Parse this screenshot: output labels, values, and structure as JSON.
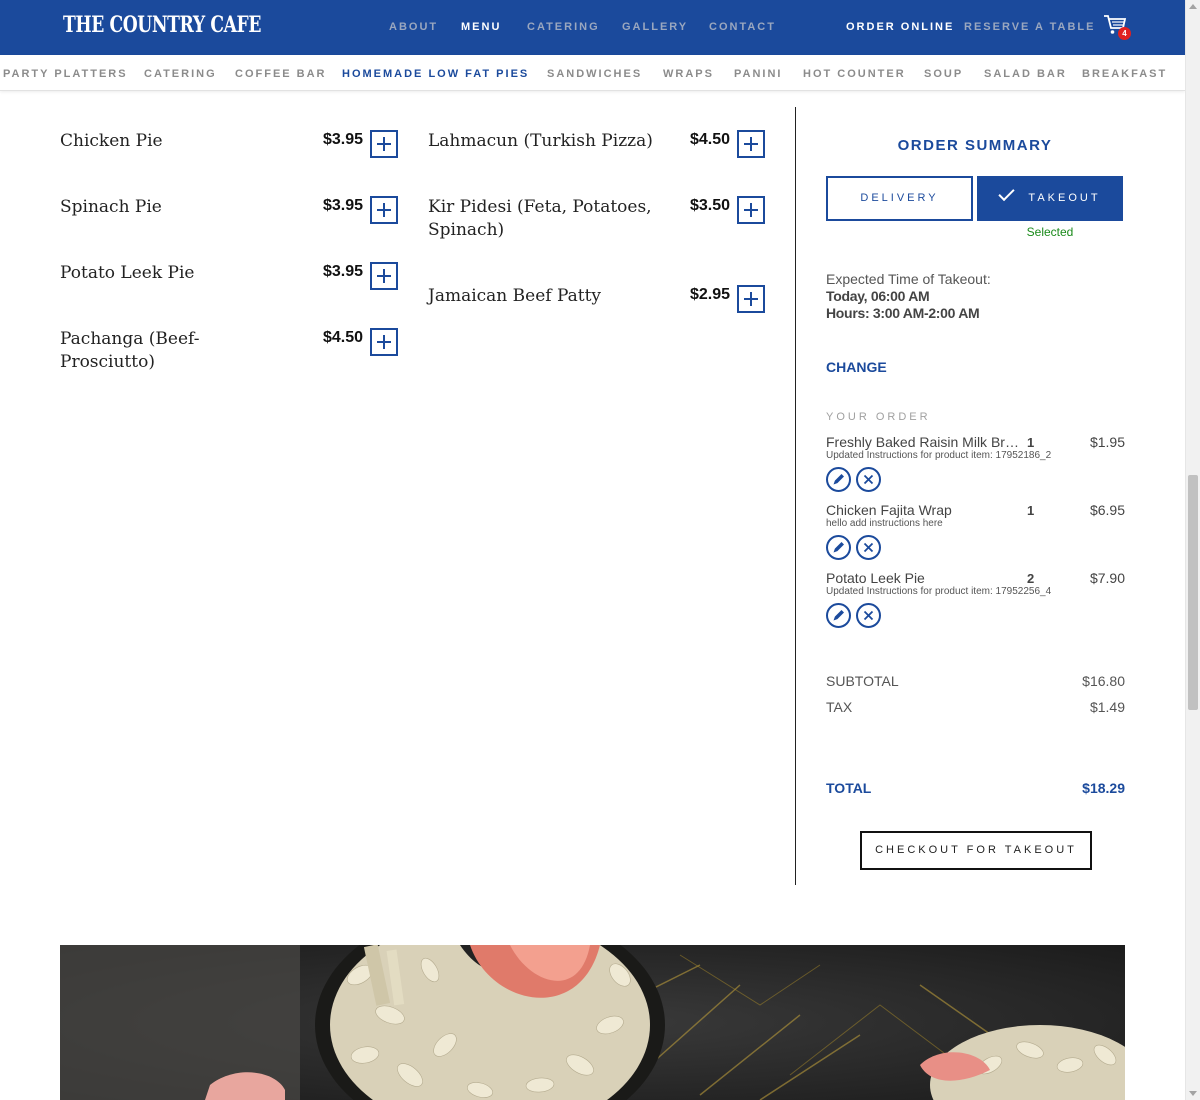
{
  "header": {
    "logo": "THE COUNTRY CAFE",
    "nav": [
      "ABOUT",
      "MENU",
      "CATERING",
      "GALLERY",
      "CONTACT"
    ],
    "active_nav": "MENU",
    "order_online": "ORDER ONLINE",
    "reserve": "RESERVE A TABLE",
    "cart_count": "4",
    "brand_color": "#1b4a9c"
  },
  "categories": [
    "PARTY PLATTERS",
    "CATERING",
    "COFFEE BAR",
    "HOMEMADE LOW FAT PIES",
    "SANDWICHES",
    "WRAPS",
    "PANINI",
    "HOT COUNTER",
    "SOUP",
    "SALAD BAR",
    "BREAKFAST"
  ],
  "active_category": "HOMEMADE LOW FAT PIES",
  "menu": {
    "left": [
      {
        "name": "Chicken Pie",
        "price": "$3.95"
      },
      {
        "name": "Spinach Pie",
        "price": "$3.95"
      },
      {
        "name": "Potato Leek Pie",
        "price": "$3.95"
      },
      {
        "name": "Pachanga (Beef-Prosciutto)",
        "price": "$4.50"
      }
    ],
    "right": [
      {
        "name": "Lahmacun (Turkish Pizza)",
        "price": "$4.50"
      },
      {
        "name": "Kir Pidesi (Feta, Potatoes, Spinach)",
        "price": "$3.50"
      },
      {
        "name": "Jamaican Beef Patty",
        "price": "$2.95"
      }
    ]
  },
  "summary": {
    "title": "ORDER SUMMARY",
    "delivery_label": "DELIVERY",
    "takeout_label": "TAKEOUT",
    "selected_note": "Selected",
    "expected_label": "Expected Time of Takeout:",
    "expected_time": "Today, 06:00 AM",
    "hours": "Hours: 3:00 AM-2:00 AM",
    "change_label": "CHANGE",
    "your_order_label": "YOUR ORDER",
    "items": [
      {
        "name": "Freshly Baked Raisin Milk Bread",
        "qty": "1",
        "price": "$1.95",
        "note": "Updated Instructions for product item: 17952186_2"
      },
      {
        "name": "Chicken Fajita Wrap",
        "qty": "1",
        "price": "$6.95",
        "note": "hello add instructions here"
      },
      {
        "name": "Potato Leek Pie",
        "qty": "2",
        "price": "$7.90",
        "note": "Updated Instructions for product item: 17952256_4"
      }
    ],
    "subtotal_label": "SUBTOTAL",
    "subtotal": "$16.80",
    "tax_label": "TAX",
    "tax": "$1.49",
    "total_label": "TOTAL",
    "total": "$18.29",
    "checkout_label": "CHECKOUT FOR TAKEOUT",
    "selected_color": "#1a8a1a"
  }
}
